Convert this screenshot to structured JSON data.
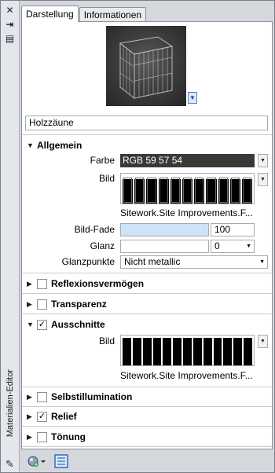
{
  "window": {
    "title": "Materialien-Editor"
  },
  "tabs": [
    {
      "label": "Darstellung",
      "active": true
    },
    {
      "label": "Informationen",
      "active": false
    }
  ],
  "icons": {
    "close": "close-icon",
    "pin": "pin-icon",
    "props": "properties-icon",
    "material": "material-icon",
    "new_material": "new-material-icon",
    "browser": "browser-icon"
  },
  "material": {
    "name": "Holzzäune"
  },
  "sections": {
    "allgemein": {
      "label": "Allgemein",
      "expanded": true,
      "farbe_label": "Farbe",
      "farbe_value": "RGB 59 57 54",
      "bild_label": "Bild",
      "bild_caption": "Sitework.Site Improvements.F...",
      "fade_label": "Bild-Fade",
      "fade_value": "100",
      "glanz_label": "Glanz",
      "glanz_value": "0",
      "glanzpunkte_label": "Glanzpunkte",
      "glanzpunkte_value": "Nicht metallic"
    },
    "reflexion": {
      "label": "Reflexionsvermögen",
      "checked": false
    },
    "transparenz": {
      "label": "Transparenz",
      "checked": false
    },
    "ausschnitte": {
      "label": "Ausschnitte",
      "checked": true,
      "bild_label": "Bild",
      "bild_caption": "Sitework.Site Improvements.F..."
    },
    "selbst": {
      "label": "Selbstillumination",
      "checked": false
    },
    "relief": {
      "label": "Relief",
      "checked": true
    },
    "toenung": {
      "label": "Tönung",
      "checked": false
    }
  },
  "colors": {
    "accent": "#2b63b8",
    "fade_fill": "#cfe2f8",
    "swatch": "#3b3936"
  }
}
